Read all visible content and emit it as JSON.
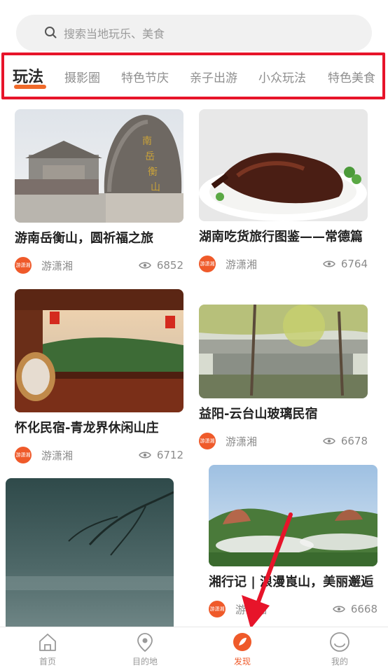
{
  "search": {
    "placeholder": "搜索当地玩乐、美食"
  },
  "tabs": [
    {
      "label": "玩法"
    },
    {
      "label": "摄影圈"
    },
    {
      "label": "特色节庆"
    },
    {
      "label": "亲子出游"
    },
    {
      "label": "小众玩法"
    },
    {
      "label": "特色美食"
    }
  ],
  "cards": [
    {
      "title": "游南岳衡山，圆祈福之旅",
      "author": "游潇湘",
      "views": "6852",
      "avatar_text": "游潇湘"
    },
    {
      "title": "湖南吃货旅行图鉴——常德篇",
      "author": "游潇湘",
      "views": "6764",
      "avatar_text": "游潇湘"
    },
    {
      "title": "怀化民宿-青龙界休闲山庄",
      "author": "游潇湘",
      "views": "6712",
      "avatar_text": "游潇湘"
    },
    {
      "title": "益阳-云台山玻璃民宿",
      "author": "游潇湘",
      "views": "6678",
      "avatar_text": "游潇湘"
    },
    {
      "title": "",
      "author": "",
      "views": "",
      "avatar_text": ""
    },
    {
      "title": "湘行记 | 浪漫崀山，美丽邂逅",
      "author": "游潇湘",
      "views": "6668",
      "avatar_text": "游潇湘"
    }
  ],
  "nav": [
    {
      "label": "首页"
    },
    {
      "label": "目的地"
    },
    {
      "label": "发现"
    },
    {
      "label": "我的"
    }
  ],
  "colors": {
    "accent": "#ef5a2a",
    "highlight_box": "#e7142a"
  }
}
